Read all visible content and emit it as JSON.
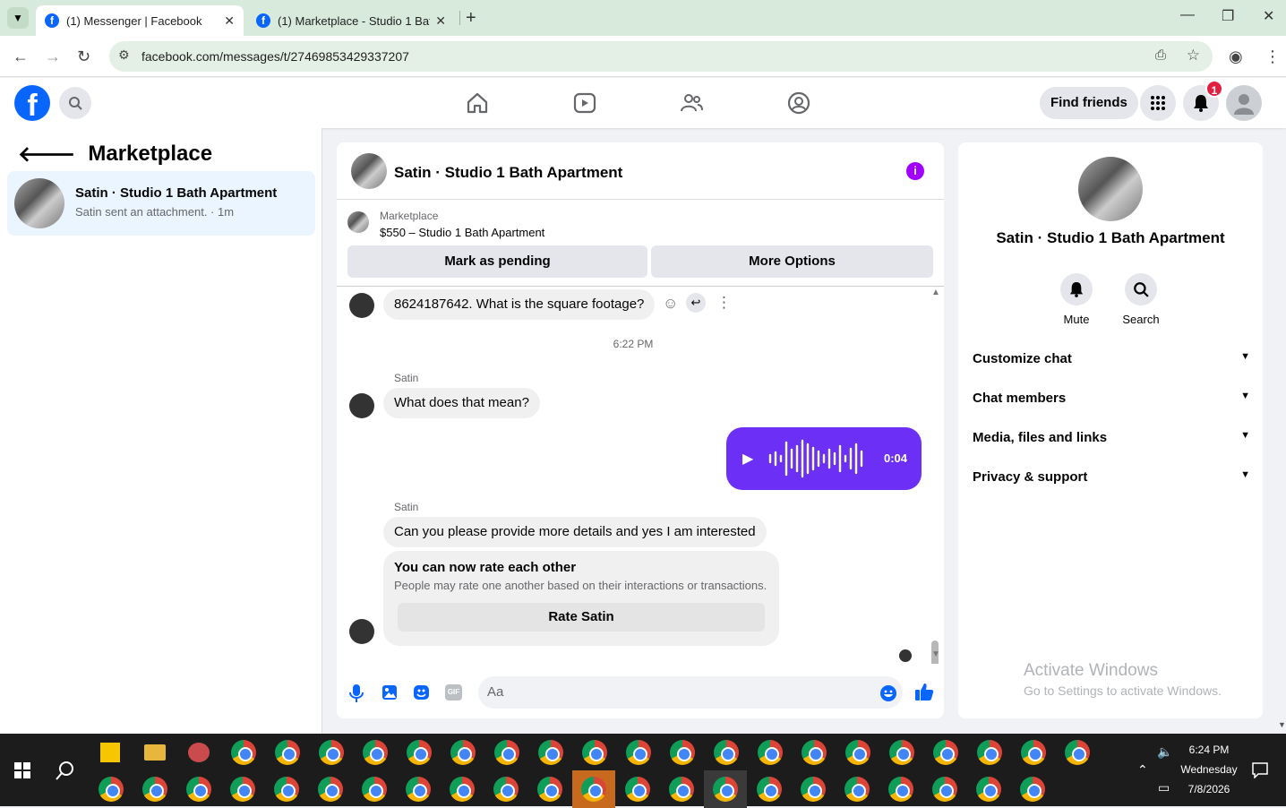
{
  "browser": {
    "tabs": [
      {
        "title": "(1) Messenger | Facebook"
      },
      {
        "title": "(1) Marketplace - Studio 1 Bath"
      }
    ],
    "url": "facebook.com/messages/t/27469853429337207"
  },
  "fb": {
    "find_friends": "Find friends",
    "notif_count": "1"
  },
  "sidebar": {
    "title": "Marketplace",
    "conversation": {
      "name": "Satin · Studio 1 Bath Apartment",
      "preview": "Satin sent an attachment. · 1m"
    }
  },
  "chat": {
    "title": "Satin · Studio 1 Bath Apartment",
    "marketplace_label": "Marketplace",
    "listing": "$550 – Studio 1 Bath Apartment",
    "mark_pending": "Mark as pending",
    "more_options": "More Options",
    "messages": {
      "m1": "8624187642.  What is the square footage?",
      "time1": "6:22 PM",
      "sender": "Satin",
      "m2": "What does that mean?",
      "voice_duration": "0:04",
      "m3": "Can you please provide more details and yes I am interested"
    },
    "rate_card": {
      "title": "You can now rate each other",
      "desc": "People may rate one another based on their interactions or transactions.",
      "button": "Rate Satin"
    },
    "composer_placeholder": "Aa"
  },
  "details": {
    "name": "Satin · Studio 1 Bath Apartment",
    "mute": "Mute",
    "search": "Search",
    "sections": [
      "Customize chat",
      "Chat members",
      "Media, files and links",
      "Privacy & support"
    ]
  },
  "watermark": {
    "line1": "Activate Windows",
    "line2": "Go to Settings to activate Windows."
  },
  "taskbar": {
    "time": "6:24 PM",
    "day": "Wednesday",
    "date": "7/8/2026"
  },
  "colors": {
    "fb_blue": "#0866ff",
    "voice_purple": "#6b2ff5",
    "info_purple": "#a100ff"
  }
}
